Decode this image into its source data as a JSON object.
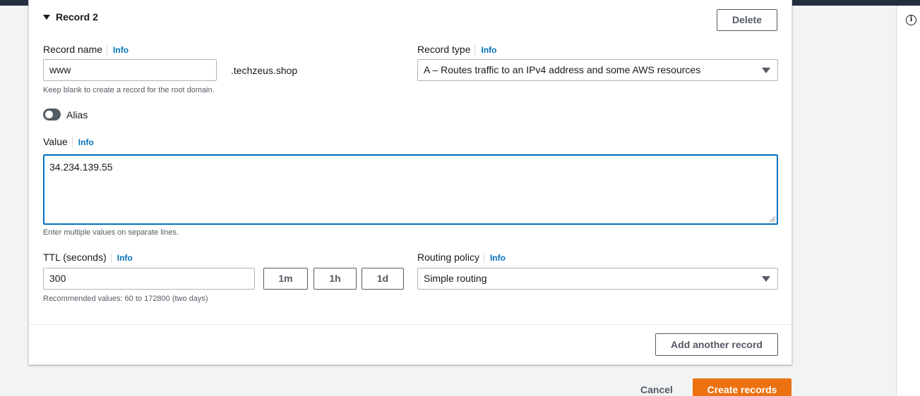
{
  "record": {
    "header": "Record 2",
    "delete_label": "Delete",
    "record_name": {
      "label": "Record name",
      "info": "Info",
      "value": "www",
      "suffix": ".techzeus.shop",
      "hint": "Keep blank to create a record for the root domain."
    },
    "record_type": {
      "label": "Record type",
      "info": "Info",
      "selected": "A – Routes traffic to an IPv4 address and some AWS resources"
    },
    "alias": {
      "label": "Alias",
      "enabled": false
    },
    "value": {
      "label": "Value",
      "info": "Info",
      "text": "34.234.139.55",
      "hint": "Enter multiple values on separate lines."
    },
    "ttl": {
      "label": "TTL (seconds)",
      "info": "Info",
      "value": "300",
      "presets": [
        "1m",
        "1h",
        "1d"
      ],
      "hint": "Recommended values: 60 to 172800 (two days)"
    },
    "routing_policy": {
      "label": "Routing policy",
      "info": "Info",
      "selected": "Simple routing"
    },
    "add_another_label": "Add another record"
  },
  "footer": {
    "cancel_label": "Cancel",
    "create_label": "Create records"
  },
  "colors": {
    "accent": "#0073bb",
    "primary": "#ec7211",
    "nav": "#232f3e"
  },
  "icons": {
    "expand": "caret-down-icon",
    "select": "dropdown-arrow-icon",
    "help": "info-circle-icon"
  }
}
